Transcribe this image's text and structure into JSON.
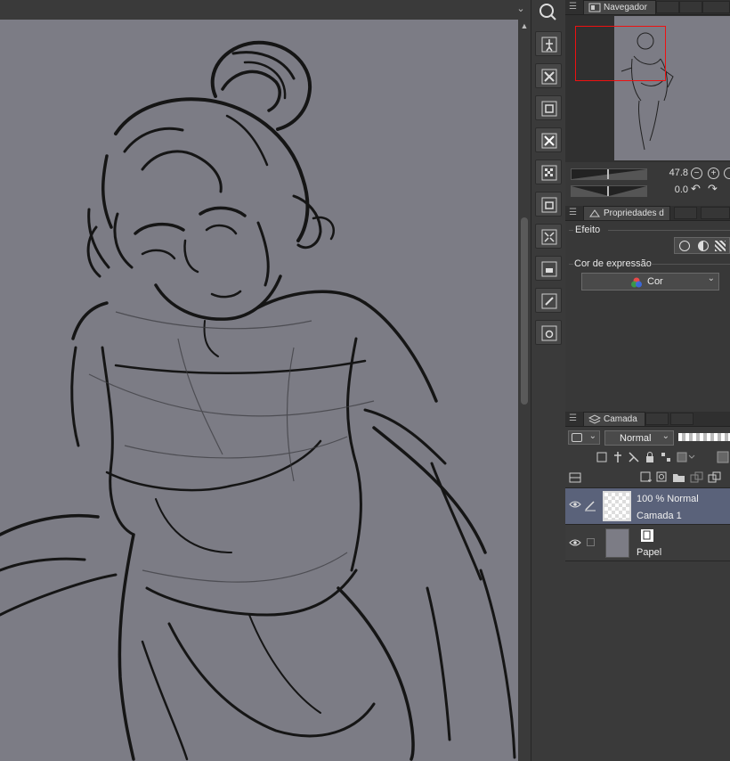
{
  "canvas": {
    "scroll_up": "▲",
    "menu_chevron": "⌄"
  },
  "navigator": {
    "tab_label": "Navegador",
    "zoom_value": "47.8",
    "rotation_value": "0.0",
    "zoom_out_icon": "−",
    "zoom_in_icon": "+",
    "rotate_left_icon": "↶",
    "rotate_right_icon": "↷"
  },
  "properties": {
    "tab_label": "Propriedades d",
    "effect_label": "Efeito",
    "expression_color_label": "Cor de expressão",
    "expression_color_value": "Cor"
  },
  "layers": {
    "tab_label": "Camada",
    "blend_mode": "Normal",
    "items": [
      {
        "top_text": "100 % Normal",
        "name": "Camada 1",
        "selected": true
      },
      {
        "top_text": "",
        "name": "Papel",
        "selected": false
      }
    ]
  },
  "icons": {
    "grip": "☰",
    "chevron_down": "⌄"
  }
}
